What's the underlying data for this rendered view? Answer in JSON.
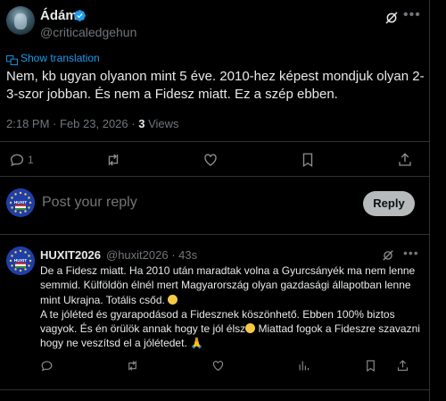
{
  "post": {
    "author_name": "Ádám",
    "author_handle": "@criticaledgehun",
    "translate_label": "Show translation",
    "text": "Nem, kb ugyan olyanon mint 5 éve. 2010-hez képest mondjuk olyan 2-3-szor jobban. És nem a Fidesz miatt. Ez a szép ebben.",
    "time": "2:18 PM",
    "separator": "·",
    "date": "Feb 23, 2026",
    "views_count": "3",
    "views_label": "Views"
  },
  "actions": {
    "reply_count": "1"
  },
  "composer": {
    "placeholder": "Post your reply",
    "reply_label": "Reply",
    "avatar_label": "HUXIT"
  },
  "reply": {
    "author_name": "HUXIT2026",
    "author_handle": "@huxit2026",
    "separator": "·",
    "time": "43s",
    "avatar_label": "HUXIT",
    "lines": [
      "De a Fidesz miatt. Ha 2010 után maradtak volna a Gyurcsányék ma nem lenne semmid. Külföldön élnél mert Magyarország olyan gazdasági állapotban lenne mint Ukrajna. Totális csőd.",
      "A te jóléted és gyarapodásod a Fidesznek köszönhető. Ebben 100% biztos vagyok. És én örülök annak hogy te jól élsz",
      "Miattad fogok a Fideszre szavazni hogy ne veszítsd el a jólétedet.",
      "🙏"
    ]
  },
  "colors": {
    "background": "#000000",
    "text": "#e7e9ea",
    "muted": "#71767b",
    "link": "#1d9bf0",
    "border": "#2f3336"
  },
  "icons": [
    "verified-badge-icon",
    "grok-icon",
    "more-icon",
    "translate-icon",
    "reply-icon",
    "repost-icon",
    "like-icon",
    "bookmark-icon",
    "share-icon",
    "analytics-icon",
    "smiley-emoji",
    "pray-emoji"
  ]
}
